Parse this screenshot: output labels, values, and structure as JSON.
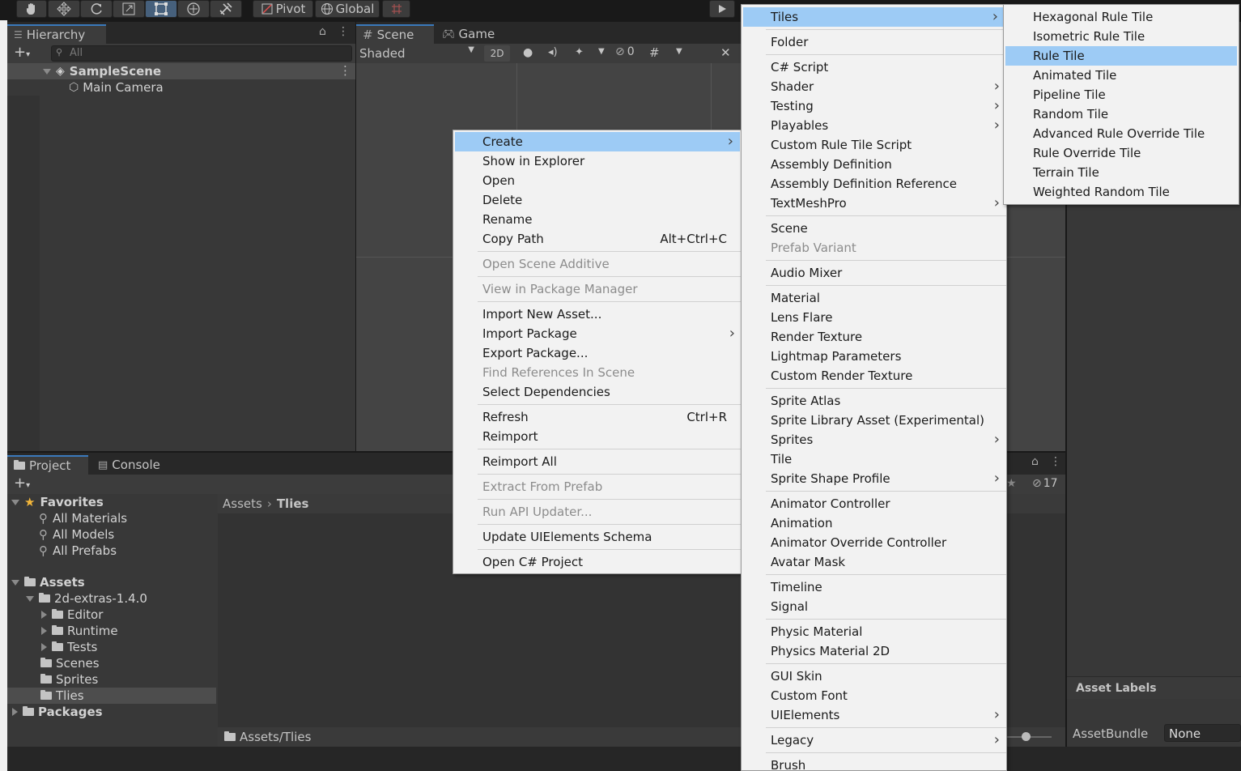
{
  "toolbar": {
    "pivot_label": "Pivot",
    "global_label": "Global"
  },
  "hierarchy": {
    "tab_label": "Hierarchy",
    "search_placeholder": "All",
    "scene_name": "SampleScene",
    "items": [
      "Main Camera"
    ]
  },
  "scene_view": {
    "scene_tab": "Scene",
    "game_tab": "Game",
    "shading_mode": "Shaded",
    "mode_2d": "2D",
    "hidden_count": "0"
  },
  "project": {
    "project_tab": "Project",
    "console_tab": "Console",
    "favorites_label": "Favorites",
    "favorites": [
      "All Materials",
      "All Models",
      "All Prefabs"
    ],
    "assets_label": "Assets",
    "extras_folder": "2d-extras-1.4.0",
    "extras_children": [
      "Editor",
      "Runtime",
      "Tests"
    ],
    "asset_folders": [
      "Scenes",
      "Sprites",
      "Tlies"
    ],
    "packages_label": "Packages",
    "breadcrumb_root": "Assets",
    "breadcrumb_current": "Tlies",
    "footer_path": "Assets/Tlies",
    "hidden_count": "17"
  },
  "inspector": {
    "asset_labels": "Asset Labels",
    "assetbundle_label": "AssetBundle",
    "assetbundle_value": "None"
  },
  "context_menu": {
    "items": [
      {
        "label": "Create",
        "arrow": true,
        "highlight": true
      },
      {
        "label": "Show in Explorer"
      },
      {
        "label": "Open"
      },
      {
        "label": "Delete"
      },
      {
        "label": "Rename"
      },
      {
        "label": "Copy Path",
        "shortcut": "Alt+Ctrl+C"
      },
      {
        "sep": true
      },
      {
        "label": "Open Scene Additive",
        "disabled": true
      },
      {
        "sep": true
      },
      {
        "label": "View in Package Manager",
        "disabled": true
      },
      {
        "sep": true
      },
      {
        "label": "Import New Asset..."
      },
      {
        "label": "Import Package",
        "arrow": true
      },
      {
        "label": "Export Package..."
      },
      {
        "label": "Find References In Scene",
        "disabled": true
      },
      {
        "label": "Select Dependencies"
      },
      {
        "sep": true
      },
      {
        "label": "Refresh",
        "shortcut": "Ctrl+R"
      },
      {
        "label": "Reimport"
      },
      {
        "sep": true
      },
      {
        "label": "Reimport All"
      },
      {
        "sep": true
      },
      {
        "label": "Extract From Prefab",
        "disabled": true
      },
      {
        "sep": true
      },
      {
        "label": "Run API Updater...",
        "disabled": true
      },
      {
        "sep": true
      },
      {
        "label": "Update UIElements Schema"
      },
      {
        "sep": true
      },
      {
        "label": "Open C# Project"
      }
    ]
  },
  "create_menu": {
    "items": [
      {
        "label": "Tiles",
        "arrow": true,
        "highlight": true
      },
      {
        "sep": true
      },
      {
        "label": "Folder"
      },
      {
        "sep": true
      },
      {
        "label": "C# Script"
      },
      {
        "label": "Shader",
        "arrow": true
      },
      {
        "label": "Testing",
        "arrow": true
      },
      {
        "label": "Playables",
        "arrow": true
      },
      {
        "label": "Custom Rule Tile Script"
      },
      {
        "label": "Assembly Definition"
      },
      {
        "label": "Assembly Definition Reference"
      },
      {
        "label": "TextMeshPro",
        "arrow": true
      },
      {
        "sep": true
      },
      {
        "label": "Scene"
      },
      {
        "label": "Prefab Variant",
        "disabled": true
      },
      {
        "sep": true
      },
      {
        "label": "Audio Mixer"
      },
      {
        "sep": true
      },
      {
        "label": "Material"
      },
      {
        "label": "Lens Flare"
      },
      {
        "label": "Render Texture"
      },
      {
        "label": "Lightmap Parameters"
      },
      {
        "label": "Custom Render Texture"
      },
      {
        "sep": true
      },
      {
        "label": "Sprite Atlas"
      },
      {
        "label": "Sprite Library Asset (Experimental)"
      },
      {
        "label": "Sprites",
        "arrow": true
      },
      {
        "label": "Tile"
      },
      {
        "label": "Sprite Shape Profile",
        "arrow": true
      },
      {
        "sep": true
      },
      {
        "label": "Animator Controller"
      },
      {
        "label": "Animation"
      },
      {
        "label": "Animator Override Controller"
      },
      {
        "label": "Avatar Mask"
      },
      {
        "sep": true
      },
      {
        "label": "Timeline"
      },
      {
        "label": "Signal"
      },
      {
        "sep": true
      },
      {
        "label": "Physic Material"
      },
      {
        "label": "Physics Material 2D"
      },
      {
        "sep": true
      },
      {
        "label": "GUI Skin"
      },
      {
        "label": "Custom Font"
      },
      {
        "label": "UIElements",
        "arrow": true
      },
      {
        "sep": true
      },
      {
        "label": "Legacy",
        "arrow": true
      },
      {
        "sep": true
      },
      {
        "label": "Brush"
      }
    ]
  },
  "tiles_menu": {
    "items": [
      {
        "label": "Hexagonal Rule Tile"
      },
      {
        "label": "Isometric Rule Tile"
      },
      {
        "label": "Rule Tile",
        "highlight": true
      },
      {
        "label": "Animated Tile"
      },
      {
        "label": "Pipeline Tile"
      },
      {
        "label": "Random Tile"
      },
      {
        "label": "Advanced Rule Override Tile"
      },
      {
        "label": "Rule Override Tile"
      },
      {
        "label": "Terrain Tile"
      },
      {
        "label": "Weighted Random Tile"
      }
    ]
  }
}
